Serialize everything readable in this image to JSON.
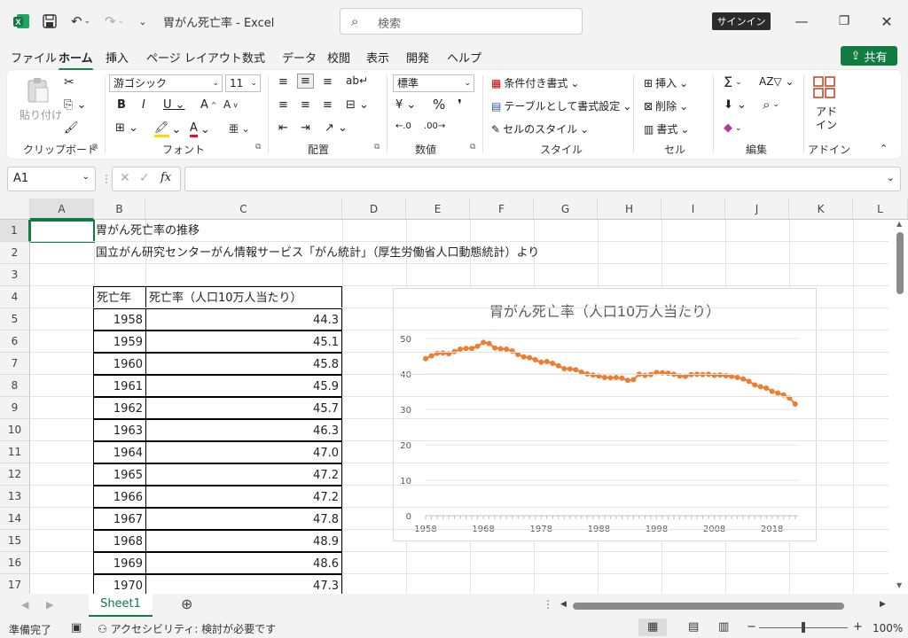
{
  "titlebar": {
    "title": "胃がん死亡率  -  Excel",
    "search_placeholder": "検索",
    "signin": "サインイン"
  },
  "tabs": [
    "ファイル",
    "ホーム",
    "挿入",
    "ページ レイアウト",
    "数式",
    "データ",
    "校閲",
    "表示",
    "開発",
    "ヘルプ"
  ],
  "share": "共有",
  "ribbon": {
    "clipboard": {
      "paste": "貼り付け",
      "label": "クリップボード"
    },
    "font": {
      "name": "游ゴシック",
      "size": "11",
      "label": "フォント"
    },
    "alignment": {
      "label": "配置"
    },
    "number": {
      "format": "標準",
      "label": "数値"
    },
    "styles": {
      "cond": "条件付き書式",
      "table": "テーブルとして書式設定",
      "cell": "セルのスタイル",
      "label": "スタイル"
    },
    "cells": {
      "insert": "挿入",
      "delete": "削除",
      "format": "書式",
      "label": "セル"
    },
    "editing": {
      "label": "編集"
    },
    "addin": {
      "name": "アド\nイン",
      "label": "アドイン"
    }
  },
  "namebox": "A1",
  "columns": [
    "A",
    "B",
    "C",
    "D",
    "E",
    "F",
    "G",
    "H",
    "I",
    "J",
    "K",
    "L"
  ],
  "rows": [
    "1",
    "2",
    "3",
    "4",
    "5",
    "6",
    "7",
    "8",
    "9",
    "10",
    "11",
    "12",
    "13",
    "14",
    "15",
    "16",
    "17"
  ],
  "cells": {
    "b1": "胃がん死亡率の推移",
    "b2": "国立がん研究センターがん情報サービス「がん統計」（厚生労働省人口動態統計）より",
    "header_year": "死亡年",
    "header_rate": "死亡率（人口10万人当たり）"
  },
  "table": [
    [
      "1958",
      "44.3"
    ],
    [
      "1959",
      "45.1"
    ],
    [
      "1960",
      "45.8"
    ],
    [
      "1961",
      "45.9"
    ],
    [
      "1962",
      "45.7"
    ],
    [
      "1963",
      "46.3"
    ],
    [
      "1964",
      "47.0"
    ],
    [
      "1965",
      "47.2"
    ],
    [
      "1966",
      "47.2"
    ],
    [
      "1967",
      "47.8"
    ],
    [
      "1968",
      "48.9"
    ],
    [
      "1969",
      "48.6"
    ],
    [
      "1970",
      "47.3"
    ]
  ],
  "chart_data": {
    "type": "line",
    "title": "胃がん死亡率（人口10万人当たり）",
    "x_ticks": [
      "1958",
      "1968",
      "1978",
      "1988",
      "1998",
      "2008",
      "2018"
    ],
    "y_ticks": [
      "0",
      "10",
      "20",
      "30",
      "40",
      "50"
    ],
    "ylim": [
      0,
      50
    ],
    "color": "#ed7d31",
    "x": [
      1958,
      1959,
      1960,
      1961,
      1962,
      1963,
      1964,
      1965,
      1966,
      1967,
      1968,
      1969,
      1970,
      1971,
      1972,
      1973,
      1974,
      1975,
      1976,
      1977,
      1978,
      1979,
      1980,
      1981,
      1982,
      1983,
      1984,
      1985,
      1986,
      1987,
      1988,
      1989,
      1990,
      1991,
      1992,
      1993,
      1994,
      1995,
      1996,
      1997,
      1998,
      1999,
      2000,
      2001,
      2002,
      2003,
      2004,
      2005,
      2006,
      2007,
      2008,
      2009,
      2010,
      2011,
      2012,
      2013,
      2014,
      2015,
      2016,
      2017,
      2018,
      2019,
      2020,
      2021,
      2022
    ],
    "values": [
      44.3,
      45.1,
      45.8,
      45.9,
      45.7,
      46.3,
      47.0,
      47.2,
      47.2,
      47.8,
      48.9,
      48.6,
      47.3,
      47.1,
      47.0,
      46.5,
      45.5,
      44.8,
      44.6,
      44.0,
      43.3,
      43.5,
      43.0,
      42.3,
      41.5,
      41.4,
      41.2,
      40.5,
      40.0,
      39.7,
      39.4,
      39.0,
      38.9,
      39.0,
      38.8,
      38.2,
      38.4,
      39.9,
      39.6,
      39.8,
      40.4,
      40.3,
      40.2,
      39.9,
      39.4,
      39.3,
      39.8,
      39.9,
      39.8,
      39.9,
      39.6,
      39.7,
      39.5,
      39.3,
      39.0,
      38.6,
      37.9,
      36.9,
      36.4,
      36.0,
      35.1,
      34.6,
      34.1,
      33.2,
      31.5
    ]
  },
  "sheet": "Sheet1",
  "status": {
    "ready": "準備完了",
    "accessibility": "アクセシビリティ: 検討が必要です",
    "zoom": "100%"
  }
}
